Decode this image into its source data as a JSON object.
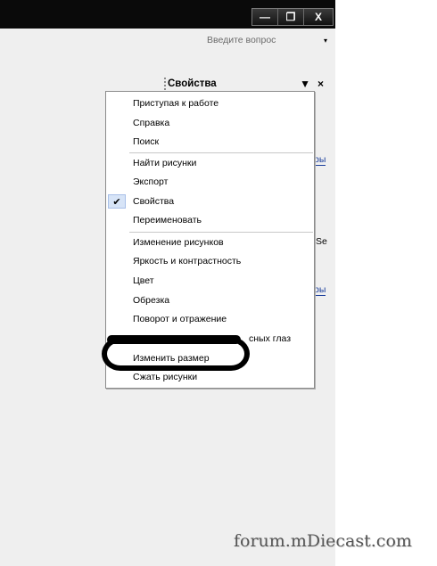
{
  "window": {
    "minimize_icon": "minimize-icon",
    "restore_icon": "restore-icon",
    "close_icon": "close-icon",
    "minimize_glyph": "—",
    "restore_glyph": "❐",
    "close_glyph": "X"
  },
  "help": {
    "placeholder": "Введите вопрос",
    "arrow": "▾"
  },
  "task_pane": {
    "title": "Свойства",
    "dropdown_glyph": "▼",
    "close_glyph": "×"
  },
  "background": {
    "link1": "ры",
    "text1": "Se",
    "link2": "ры"
  },
  "menu": {
    "items": [
      {
        "label": "Приступая к работе"
      },
      {
        "label": "Справка"
      },
      {
        "label": "Поиск"
      },
      {
        "label": "Найти рисунки"
      },
      {
        "label": "Экспорт"
      },
      {
        "label": "Свойства",
        "checked": true,
        "check_glyph": "✔"
      },
      {
        "label": "Переименовать"
      },
      {
        "label": "Изменение рисунков"
      },
      {
        "label": "Яркость и контрастность"
      },
      {
        "label": "Цвет"
      },
      {
        "label": "Обрезка"
      },
      {
        "label": "Поворот и отражение"
      },
      {
        "label": "сных глаз"
      },
      {
        "label": "Изменить размер"
      },
      {
        "label": "Сжать рисунки"
      }
    ]
  },
  "watermark": "forum.mDiecast.com"
}
